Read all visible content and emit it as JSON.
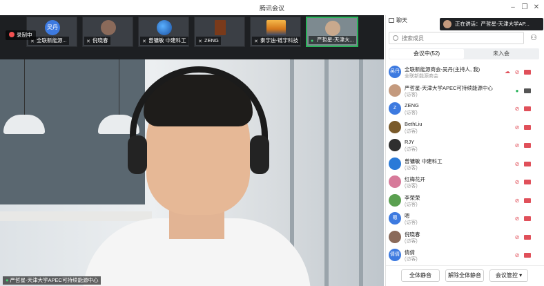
{
  "window": {
    "title": "腾讯会议"
  },
  "record": {
    "label": "录制中"
  },
  "thumbnails": [
    {
      "label": "全联新能源...",
      "avatar_text": "吴丹",
      "kind": "avatar"
    },
    {
      "label": "倪晓春",
      "kind": "face"
    },
    {
      "label": "曾镛敏 中建科工",
      "kind": "globe"
    },
    {
      "label": "ZENG",
      "kind": "poster"
    },
    {
      "label": "秦宇迪-链宇科技",
      "kind": "sunset"
    },
    {
      "label": "严哲星-天津大...",
      "kind": "face",
      "active": true
    }
  ],
  "main_video": {
    "speaker_label": "严哲星-天津大学APEC可持续能源中心"
  },
  "panel": {
    "chat_tab": "聊天",
    "speaking_banner": "正在讲话：严哲星-天津大学AP...",
    "search_placeholder": "搜索成员",
    "tabs": {
      "in_meeting": "会议中(52)",
      "not_joined": "未入会"
    },
    "participants": [
      {
        "avatar_text": "吴丹",
        "name": "全联新能源商会-吴丹(主持人, 我)",
        "role": "全联新能源商会",
        "mic": "off",
        "cam": "off",
        "net": true
      },
      {
        "avatar_text": "",
        "name": "严哲星-天津大学APEC可持续能源中心",
        "role": "(访客)",
        "mic": "on",
        "cam": "on"
      },
      {
        "avatar_text": "Z",
        "name": "ZENG",
        "role": "(访客)",
        "mic": "off",
        "cam": "off"
      },
      {
        "avatar_text": "",
        "name": "BethLiu",
        "role": "(访客)",
        "mic": "off",
        "cam": "off"
      },
      {
        "avatar_text": "",
        "name": "RJY",
        "role": "(访客)",
        "mic": "off",
        "cam": "off"
      },
      {
        "avatar_text": "",
        "name": "曾镛敏 中建科工",
        "role": "(访客)",
        "mic": "off",
        "cam": "off"
      },
      {
        "avatar_text": "",
        "name": "红梅花开",
        "role": "(访客)",
        "mic": "off",
        "cam": "off"
      },
      {
        "avatar_text": "",
        "name": "李荣荣",
        "role": "(访客)",
        "mic": "off",
        "cam": "off"
      },
      {
        "avatar_text": "嗯",
        "name": "嗯",
        "role": "(访客)",
        "mic": "off",
        "cam": "off"
      },
      {
        "avatar_text": "",
        "name": "倪晓春",
        "role": "(访客)",
        "mic": "off",
        "cam": "off"
      },
      {
        "avatar_text": "倩倩",
        "name": "倩倩",
        "role": "(访客)",
        "mic": "off",
        "cam": "off"
      }
    ],
    "buttons": {
      "mute_all": "全体静音",
      "unmute_all": "解除全体静音",
      "manage": "会议管控 ▾"
    }
  },
  "colors": {
    "accent": "#3d7ae0",
    "active_green": "#29b35a",
    "muted_red": "#e0505a"
  }
}
